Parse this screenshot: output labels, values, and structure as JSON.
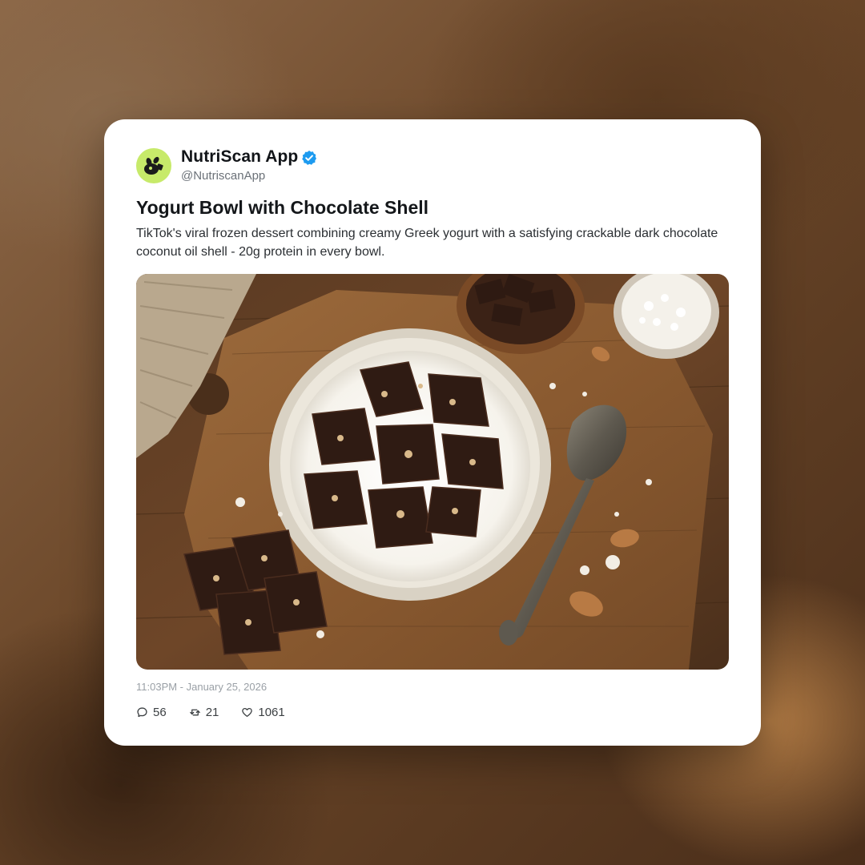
{
  "profile": {
    "name": "NutriScan App",
    "handle": "@NutriscanApp",
    "verified": true,
    "avatar_icon": "leaf-logo-icon",
    "avatar_color": "#c7ea6a"
  },
  "post": {
    "title": "Yogurt Bowl with Chocolate Shell",
    "body": "TikTok's viral frozen dessert combining creamy Greek yogurt with a satisfying crackable dark chocolate coconut oil shell - 20g protein in every bowl.",
    "image_icon": "food-photo",
    "timestamp": "11:03PM - January 25, 2026"
  },
  "stats": {
    "replies": "56",
    "reposts": "21",
    "likes": "1061"
  },
  "colors": {
    "verified_badge": "#1d9bf0",
    "text_primary": "#111418",
    "text_secondary": "#6b7178"
  }
}
